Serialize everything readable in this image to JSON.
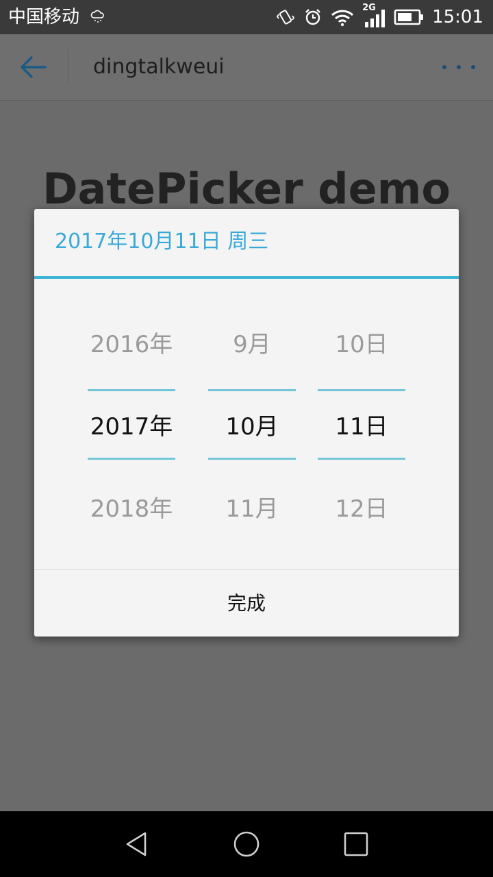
{
  "status_bar": {
    "carrier": "中国移动",
    "network_type": "2G",
    "time": "15:01",
    "icons": [
      "cloud-icon",
      "vibrate-icon",
      "alarm-icon",
      "wifi-icon",
      "signal-icon",
      "battery-icon"
    ]
  },
  "header": {
    "title": "dingtalkweui",
    "back_icon": "arrow-left-icon",
    "more_icon": "more-dots-icon",
    "accent_color": "#1a5a85"
  },
  "page": {
    "title": "DatePicker demo"
  },
  "dialog": {
    "selected_date": "2017年10月11日 周三",
    "accent_color": "#39a9d8",
    "picker": {
      "year": {
        "prev": "2016年",
        "current": "2017年",
        "next": "2018年"
      },
      "month": {
        "prev": "9月",
        "current": "10月",
        "next": "11月"
      },
      "day": {
        "prev": "10日",
        "current": "11日",
        "next": "12日"
      }
    },
    "done_label": "完成"
  },
  "nav_bar": {
    "icons": [
      "nav-back-icon",
      "nav-home-icon",
      "nav-recent-icon"
    ]
  }
}
